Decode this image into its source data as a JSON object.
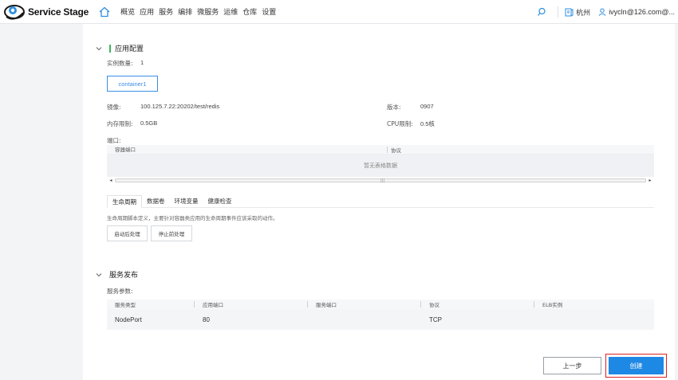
{
  "header": {
    "app_name": "Service Stage",
    "nav": [
      "概览",
      "应用",
      "服务",
      "编排",
      "微服务",
      "运维",
      "仓库",
      "设置"
    ],
    "region": "杭州",
    "user": "ivycln@126.com@..."
  },
  "app_config": {
    "title": "应用配置",
    "instance_label": "实例数量:",
    "instance_value": "1",
    "container_tab": "container1",
    "image_label": "镜像:",
    "image_value": "100.125.7.22:20202/test/redis",
    "version_label": "版本:",
    "version_value": "0907",
    "mem_label": "内存限制:",
    "mem_value": "0.5GB",
    "cpu_label": "CPU限制:",
    "cpu_value": "0.5核",
    "port_label": "端口:",
    "port_table": {
      "columns": [
        "容器端口",
        "协议"
      ],
      "empty_text": "暂无表格数据"
    },
    "tabs": [
      "生命周期",
      "数据卷",
      "环境变量",
      "健康检查"
    ],
    "active_tab": "生命周期",
    "lifecycle_desc": "生命周期脚本定义，主要针对容器类应用的生命周期事件应该采取的动作。",
    "post_start": "启动后处理",
    "pre_stop": "停止前处理"
  },
  "service_publish": {
    "title": "服务发布",
    "params_label": "服务参数:",
    "columns": [
      "服务类型",
      "应用端口",
      "服务端口",
      "协议",
      "ELB实例"
    ],
    "rows": [
      [
        "NodePort",
        "80",
        "",
        "TCP",
        ""
      ]
    ]
  },
  "footer": {
    "prev": "上一步",
    "create": "创建"
  },
  "colors": {
    "accent": "#1e88e5",
    "section_bar": "#3db55a",
    "highlight_border": "#e02020"
  }
}
